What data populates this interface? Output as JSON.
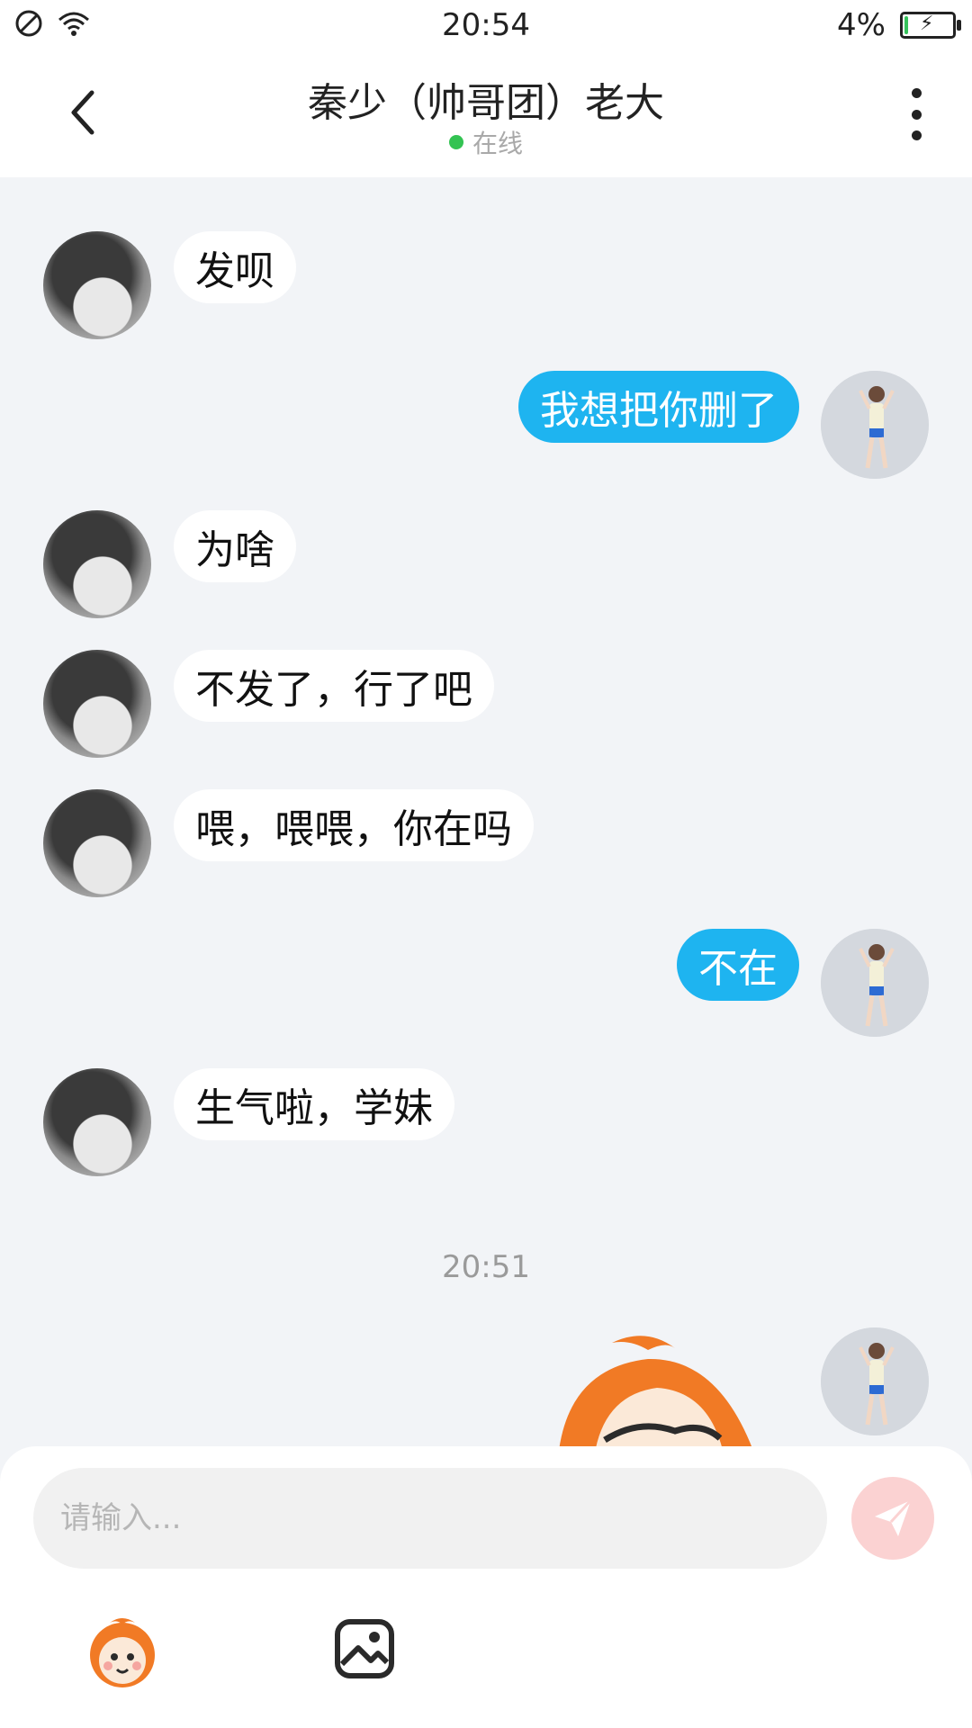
{
  "status_bar": {
    "time": "20:54",
    "battery": "4%"
  },
  "header": {
    "title": "秦少（帅哥团）老大",
    "presence": "在线"
  },
  "messages": [
    {
      "from": "them",
      "text": "发呗"
    },
    {
      "from": "me",
      "text": "我想把你删了"
    },
    {
      "from": "them",
      "text": "为啥"
    },
    {
      "from": "them",
      "text": "不发了，行了吧"
    },
    {
      "from": "them",
      "text": "喂，喂喂，你在吗"
    },
    {
      "from": "me",
      "text": "不在"
    },
    {
      "from": "them",
      "text": "生气啦，学妹"
    }
  ],
  "timestamp": "20:51",
  "input": {
    "placeholder": "请输入..."
  },
  "icons": {
    "back": "chevron-left-icon",
    "more": "more-vertical-icon",
    "send": "paper-plane-icon",
    "emoji": "monkey-emoji-icon",
    "image": "image-icon"
  },
  "colors": {
    "bubble_me": "#1eb4f0",
    "bubble_them": "#ffffff",
    "background": "#f2f4f7",
    "online": "#33c352"
  }
}
